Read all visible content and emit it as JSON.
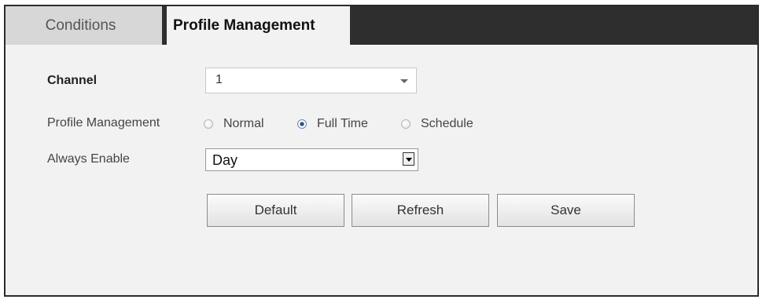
{
  "tabs": [
    {
      "label": "Conditions",
      "active": false
    },
    {
      "label": "Profile Management",
      "active": true
    }
  ],
  "form": {
    "channel": {
      "label": "Channel",
      "value": "1"
    },
    "profile_management": {
      "label": "Profile Management",
      "options": [
        {
          "label": "Normal",
          "checked": false
        },
        {
          "label": "Full Time",
          "checked": true
        },
        {
          "label": "Schedule",
          "checked": false
        }
      ]
    },
    "always_enable": {
      "label": "Always Enable",
      "value": "Day"
    }
  },
  "buttons": {
    "default_label": "Default",
    "refresh_label": "Refresh",
    "save_label": "Save"
  },
  "colors": {
    "tab_bar": "#2e2e2e",
    "panel_bg": "#f2f2f2",
    "inactive_tab": "#d7d7d7",
    "radio_checked": "#2c4f8c"
  }
}
